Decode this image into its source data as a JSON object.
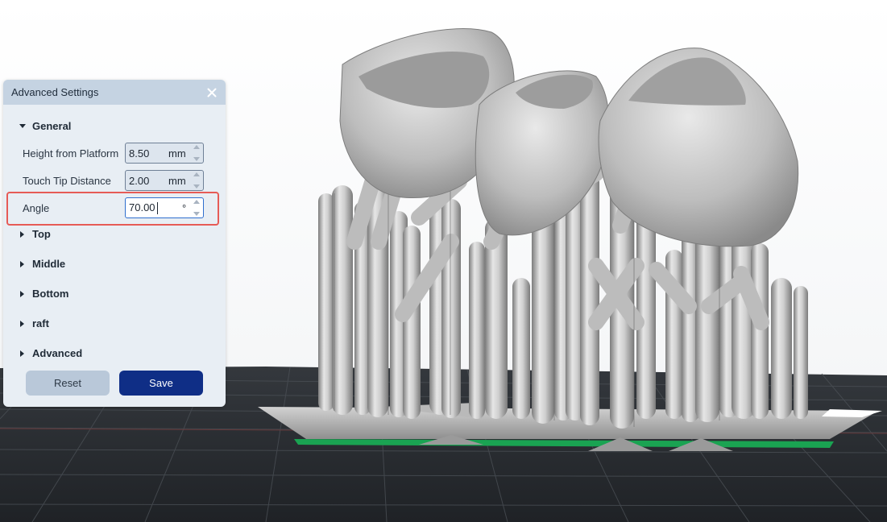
{
  "panel": {
    "title": "Advanced Settings",
    "close_icon": "close-icon"
  },
  "general": {
    "label": "General",
    "expanded": true,
    "fields": [
      {
        "label": "Height from Platform",
        "value": "8.50",
        "unit": "mm"
      },
      {
        "label": "Touch Tip Distance",
        "value": "2.00",
        "unit": "mm"
      },
      {
        "label": "Angle",
        "value": "70.00",
        "unit": "°"
      }
    ]
  },
  "sections": [
    {
      "label": "Top"
    },
    {
      "label": "Middle"
    },
    {
      "label": "Bottom"
    },
    {
      "label": "raft"
    },
    {
      "label": "Advanced"
    }
  ],
  "buttons": {
    "reset": "Reset",
    "save": "Save"
  },
  "colors": {
    "panel_bg": "#e8eef4",
    "header_bg": "#c5d3e2",
    "save_bg": "#0f2e86",
    "reset_bg": "#b9c8d9",
    "highlight": "#e65b56",
    "active_border": "#2f6fce",
    "platform_edge": "#1aa352"
  }
}
